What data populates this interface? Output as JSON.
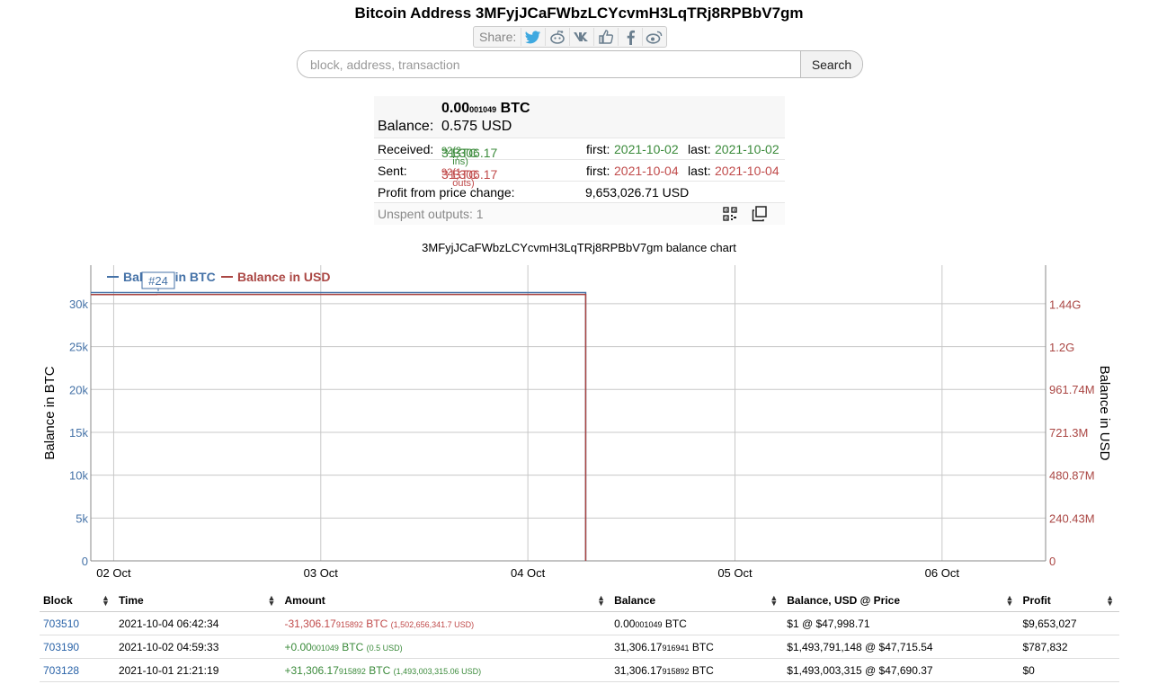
{
  "page_title": "Bitcoin Address 3MFyjJCaFWbzLCYcvmH3LqTRj8RPBbV7gm",
  "share": {
    "label": "Share:",
    "icons": [
      "twitter-icon",
      "reddit-icon",
      "vk-icon",
      "like-icon",
      "facebook-icon",
      "weibo-icon"
    ]
  },
  "search": {
    "placeholder": "block, address, transaction",
    "button_label": "Search"
  },
  "summary": {
    "balance_btc_main": "0.00",
    "balance_btc_small": "001049",
    "balance_unit": "BTC",
    "balance_label": "Balance:",
    "balance_usd": "0.575 USD",
    "received_label": "Received:",
    "received_btc_main": "31,306.17",
    "received_btc_small": "92",
    "received_unit": "BTC",
    "received_count": "(2 ins)",
    "received_first_label": "first:",
    "received_first": "2021-10-02",
    "received_last_label": "last:",
    "received_last": "2021-10-02",
    "sent_label": "Sent:",
    "sent_btc_main": "31,306.17",
    "sent_btc_small": "92",
    "sent_unit": "BTC",
    "sent_count": "(1 outs)",
    "sent_first_label": "first:",
    "sent_first": "2021-10-04",
    "sent_last_label": "last:",
    "sent_last": "2021-10-04",
    "profit_label": "Profit from price change:",
    "profit_value": "9,653,026.71 USD",
    "unspent_label": "Unspent outputs: 1"
  },
  "chart_title": "3MFyjJCaFWbzLCYcvmH3LqTRj8RPBbV7gm balance chart",
  "colors": {
    "btc": "#4572a7",
    "usd": "#aa4643",
    "green": "#3a8a3a",
    "red": "#c04a4a",
    "link": "#2a63a8"
  },
  "chart_data": {
    "type": "line",
    "title": "3MFyjJCaFWbzLCYcvmH3LqTRj8RPBbV7gm balance chart",
    "xlabel": "",
    "ylabel": "Balance in BTC",
    "y2label": "Balance in USD",
    "x_ticks": [
      "02 Oct",
      "03 Oct",
      "04 Oct",
      "05 Oct",
      "06 Oct"
    ],
    "y_ticks": [
      "0",
      "5k",
      "10k",
      "15k",
      "20k",
      "25k",
      "30k"
    ],
    "y_tick_values": [
      0,
      5000,
      10000,
      15000,
      20000,
      25000,
      30000
    ],
    "y2_ticks": [
      "0",
      "240.43M",
      "480.87M",
      "721.3M",
      "961.74M",
      "1.2G",
      "1.44G"
    ],
    "y2_tick_values": [
      0,
      240430000,
      480870000,
      721300000,
      961740000,
      1200000000,
      1440000000
    ],
    "xlim": [
      "2021-10-01 21:21",
      "2021-10-06 12:00"
    ],
    "ylim": [
      0,
      34500
    ],
    "y2lim": [
      0,
      1658000000
    ],
    "grid": true,
    "legend": "top-left",
    "annotation": "#24",
    "series": [
      {
        "name": "Balance in BTC",
        "axis": "left",
        "points": [
          [
            "2021-10-01 21:21",
            31306.18
          ],
          [
            "2021-10-02 04:59",
            31306.18
          ],
          [
            "2021-10-04 06:42",
            1.049e-05
          ]
        ]
      },
      {
        "name": "Balance in USD",
        "axis": "right",
        "points": [
          [
            "2021-10-01 21:21",
            1493003315
          ],
          [
            "2021-10-02 04:59",
            1493791148
          ],
          [
            "2021-10-04 06:42",
            1
          ]
        ]
      }
    ]
  },
  "table": {
    "headers": [
      "Block",
      "Time",
      "Amount",
      "Balance",
      "Balance, USD @ Price",
      "Profit"
    ],
    "rows": [
      {
        "block": "703510",
        "time": "2021-10-04 06:42:34",
        "amount_main": "-31,306.17",
        "amount_small": "915892",
        "amount_unit": "BTC",
        "amount_usd": "(1,502,656,341.7 USD)",
        "amount_sign": "neg",
        "balance_main": "0.00",
        "balance_small": "001049",
        "balance_unit": "BTC",
        "balance_usd": "$1 @ $47,998.71",
        "profit": "$9,653,027"
      },
      {
        "block": "703190",
        "time": "2021-10-02 04:59:33",
        "amount_main": "+0.00",
        "amount_small": "001049",
        "amount_unit": "BTC",
        "amount_usd": "(0.5 USD)",
        "amount_sign": "pos",
        "balance_main": "31,306.17",
        "balance_small": "916941",
        "balance_unit": "BTC",
        "balance_usd": "$1,493,791,148 @ $47,715.54",
        "profit": "$787,832"
      },
      {
        "block": "703128",
        "time": "2021-10-01 21:21:19",
        "amount_main": "+31,306.17",
        "amount_small": "915892",
        "amount_unit": "BTC",
        "amount_usd": "(1,493,003,315.06 USD)",
        "amount_sign": "pos",
        "balance_main": "31,306.17",
        "balance_small": "915892",
        "balance_unit": "BTC",
        "balance_usd": "$1,493,003,315 @ $47,690.37",
        "profit": "$0"
      }
    ]
  }
}
